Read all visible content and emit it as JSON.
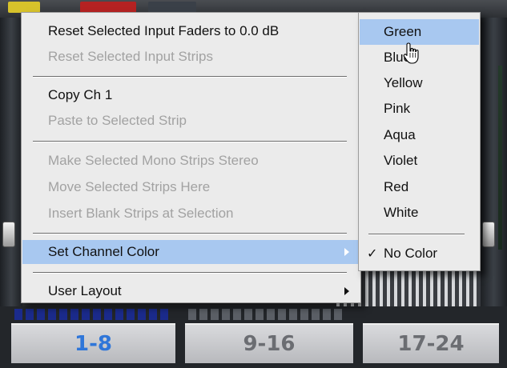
{
  "banks": [
    {
      "label": "1-8",
      "active": true
    },
    {
      "label": "9-16",
      "active": false
    },
    {
      "label": "17-24",
      "active": false
    }
  ],
  "context_menu": {
    "items": [
      {
        "label": "Reset Selected Input Faders to 0.0 dB",
        "enabled": true
      },
      {
        "label": "Reset Selected Input Strips",
        "enabled": false
      },
      {
        "label": "Copy Ch 1",
        "enabled": true
      },
      {
        "label": "Paste to Selected Strip",
        "enabled": false
      },
      {
        "label": "Make Selected Mono Strips Stereo",
        "enabled": false
      },
      {
        "label": "Move Selected Strips Here",
        "enabled": false
      },
      {
        "label": "Insert Blank Strips at Selection",
        "enabled": false
      },
      {
        "label": "Set Channel Color",
        "enabled": true,
        "highlighted": true,
        "submenu": true
      },
      {
        "label": "User Layout",
        "enabled": true,
        "submenu": true
      }
    ]
  },
  "color_submenu": {
    "items": [
      {
        "label": "Green",
        "highlighted": true
      },
      {
        "label": "Blue"
      },
      {
        "label": "Yellow"
      },
      {
        "label": "Pink"
      },
      {
        "label": "Aqua"
      },
      {
        "label": "Violet"
      },
      {
        "label": "Red"
      },
      {
        "label": "White"
      }
    ],
    "no_color": {
      "label": "No Color",
      "checked": true,
      "check_glyph": "✓"
    }
  },
  "colors": {
    "highlight": "#a8c8f0",
    "active_bank": "#2f76d9",
    "bank_led": "#1b2b8c",
    "menu_bg": "#ebebeb"
  }
}
